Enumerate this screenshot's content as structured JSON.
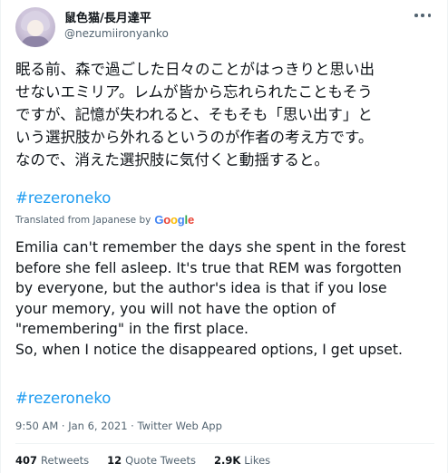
{
  "user": {
    "display_name": "鼠色猫/長月達平",
    "handle": "@nezumiironyanko",
    "avatar_icon": "avatar-icon"
  },
  "tweet": {
    "original_text": "眠る前、森で過ごした日々のことがはっきりと思い出\nせないエミリア。レムが皆から忘れられたこともそう\nですが、記憶が失われると、そもそも「思い出す」と\nいう選択肢から外れるというのが作者の考え方です。\nなので、消えた選択肢に気付くと動揺すると。",
    "hashtag_original": "#rezeroneko",
    "translated_from": "Translated from Japanese by",
    "translator": {
      "G": "G",
      "o1": "o",
      "o2": "o",
      "g": "g",
      "l": "l",
      "e": "e"
    },
    "translation_text": "Emilia can't remember the days she spent in the forest\nbefore she fell asleep. It's true that REM was forgotten\nby everyone, but the author's idea is that if you lose\nyour memory, you will not have the option of\n\"remembering\" in the first place.\n So, when I notice the disappeared options, I get upset.",
    "hashtag_translation": "#rezeroneko",
    "meta": "9:50 AM · Jan 6, 2021 · Twitter Web App"
  },
  "stats": {
    "retweets_count": "407",
    "retweets_label": "Retweets",
    "quotes_count": "12",
    "quotes_label": "Quote Tweets",
    "likes_count": "2.9K",
    "likes_label": "Likes"
  },
  "colors": {
    "link": "#1d9bf0",
    "text": "#0f1419",
    "secondary": "#536471",
    "divider": "#eff3f4"
  }
}
